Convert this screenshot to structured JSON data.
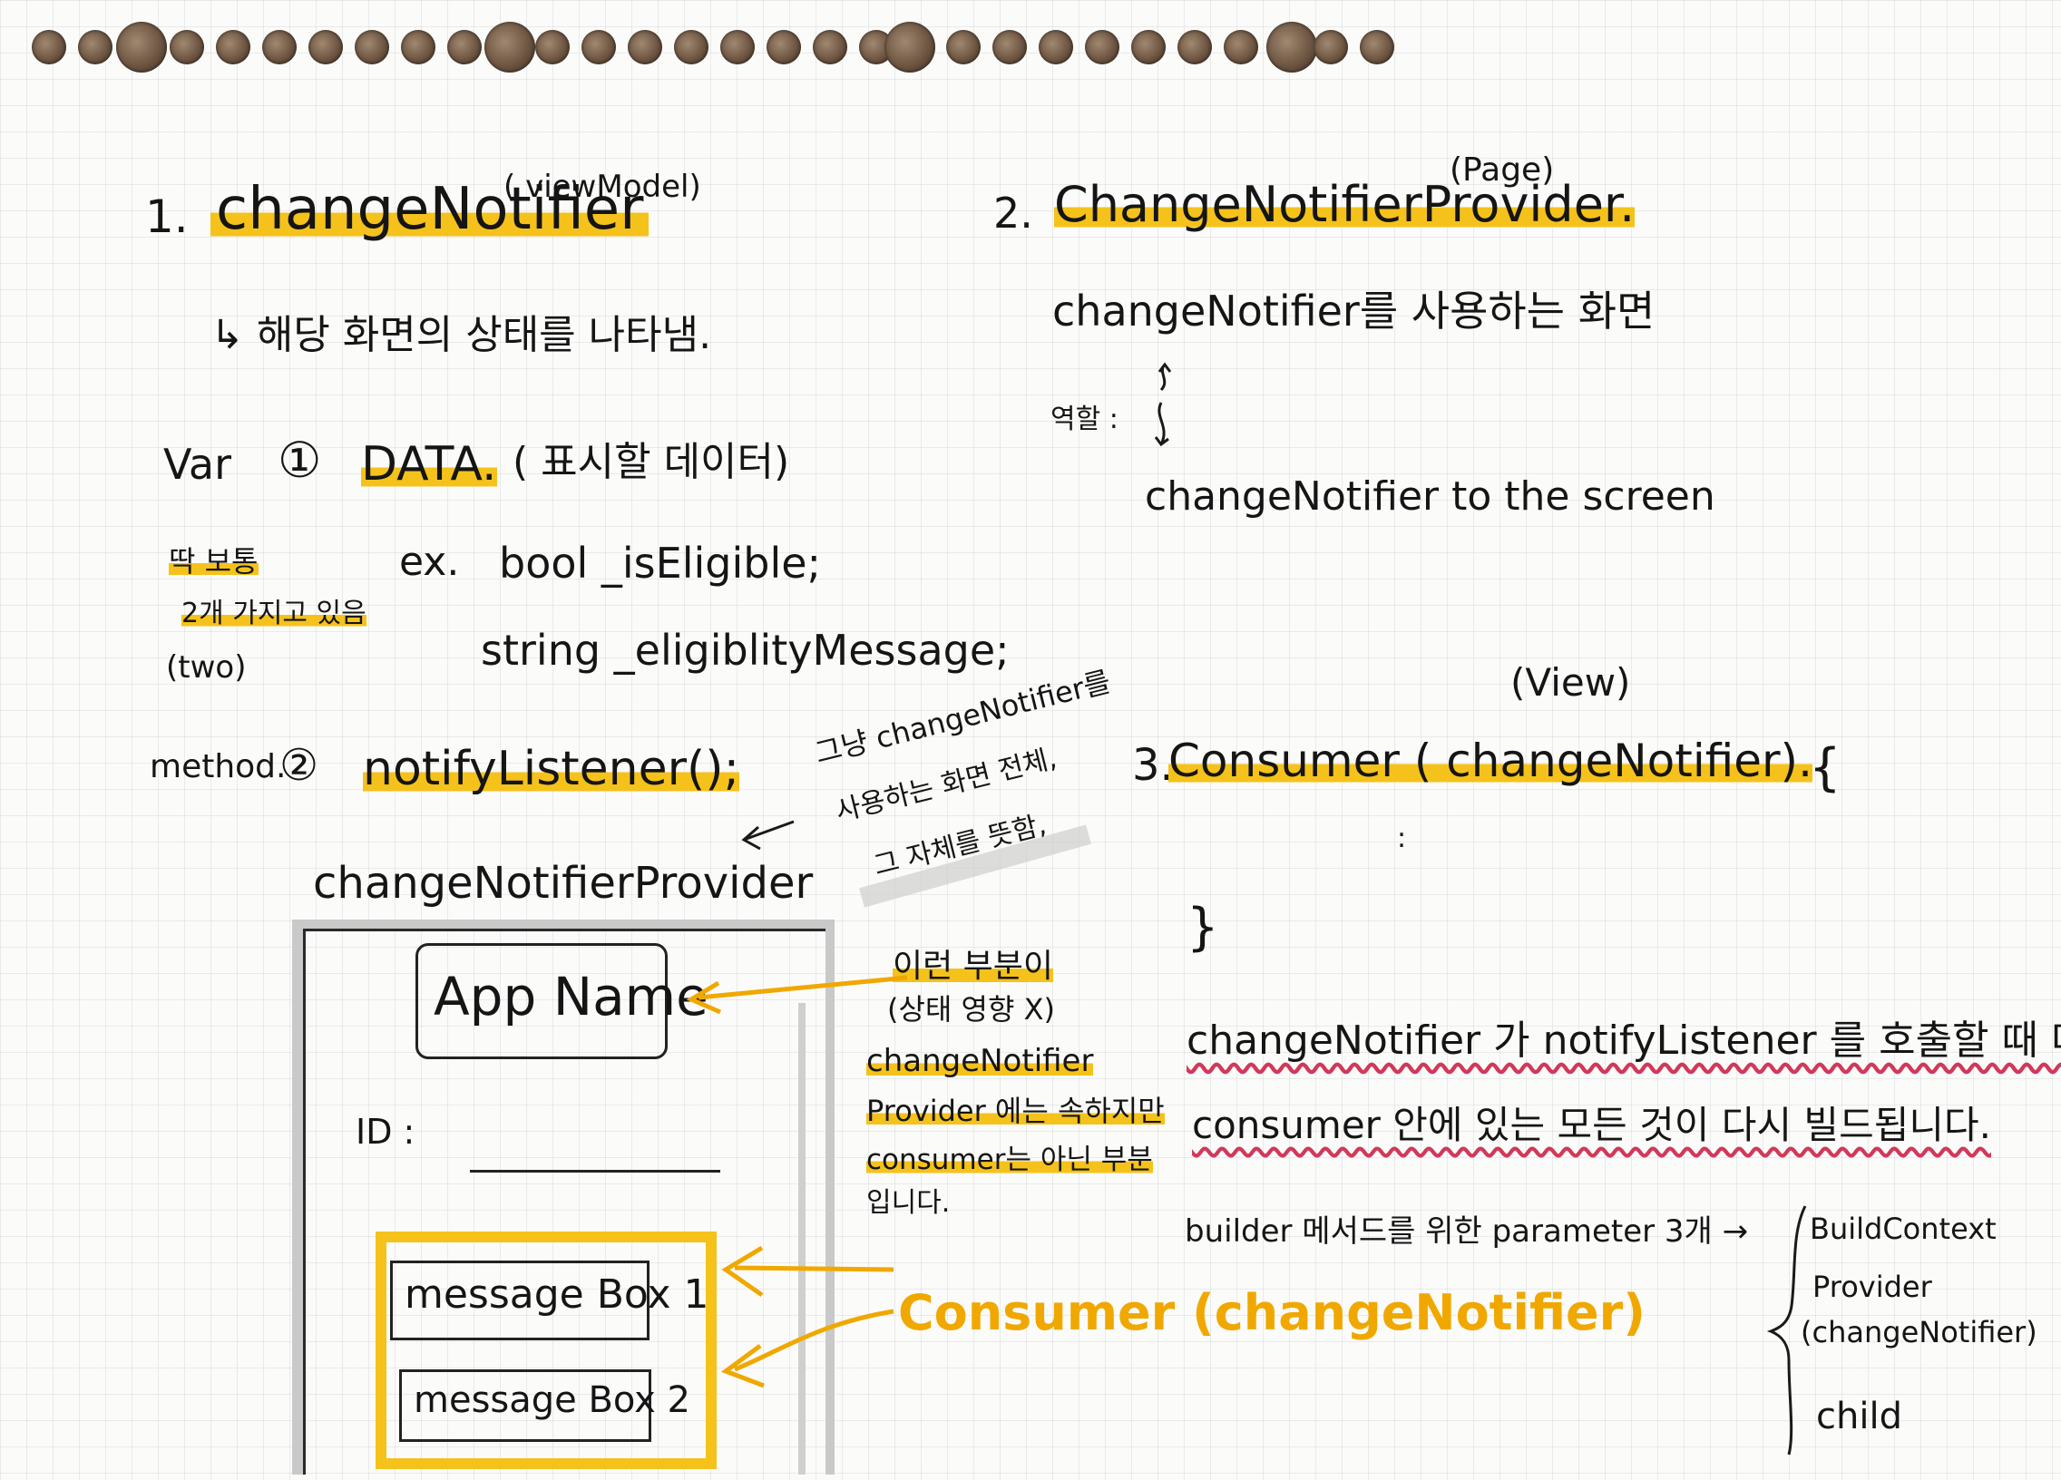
{
  "section1": {
    "number": "1.",
    "title": "changeNotifier",
    "tag": "( viewModel)",
    "desc": "↳ 해당 화면의 상태를 나타냄.",
    "var_label": "Var",
    "item1_num": "①",
    "item1_name": "DATA.",
    "item1_desc": "( 표시할 데이터)",
    "side_note_1": "딱 보통",
    "side_note_2": "2개 가지고 있음",
    "side_note_3": "(two)",
    "example_prefix": "ex.",
    "example_line1": "bool _isEligible;",
    "example_line2": "string _eligiblityMessage;",
    "method_label": "method.",
    "item2_num": "②",
    "item2_name": "notifyListener();"
  },
  "section2": {
    "number": "2.",
    "title": "ChangeNotifierProvider.",
    "tag": "(Page)",
    "line1": "changeNotifier를 사용하는 화면",
    "role_label": "역할 :",
    "line2": "changeNotifier to the screen"
  },
  "diagram": {
    "provider_label": "changeNotifierProvider",
    "provider_note_1": "그냥 changeNotifier를",
    "provider_note_2": "사용하는 화면 전체,",
    "provider_note_3": "그 자체를 뜻함,",
    "app_name": "App Name",
    "id_label": "ID :",
    "box1": "message Box 1",
    "box2": "message Box 2",
    "note_1": "이런 부분이",
    "note_2": "(상태 영향 X)",
    "note_3": "changeNotifier",
    "note_4": "Provider 에는 속하지만",
    "note_5": "consumer는 아닌 부분",
    "note_6": "입니다.",
    "consumer_label": "Consumer (changeNotifier)"
  },
  "section3": {
    "number": "3.",
    "title": "Consumer ( changeNotifier).",
    "tag": "(View)",
    "brace_open": "{",
    "ellipsis": ":",
    "brace_close": "}",
    "sentence1": "changeNotifier 가  notifyListener 를 호출할 때 마다",
    "sentence2": "consumer 안에 있는 모든 것이 다시 빌드됩니다.",
    "builder_text": "builder 메서드를 위한 parameter 3개 →",
    "params": [
      "BuildContext",
      "Provider",
      "(changeNotifier)",
      "child"
    ]
  },
  "colors": {
    "highlight": "#f5c21b",
    "ink": "#151515",
    "wavy_underline": "#d0395a",
    "orange_ink": "#f0a800"
  }
}
